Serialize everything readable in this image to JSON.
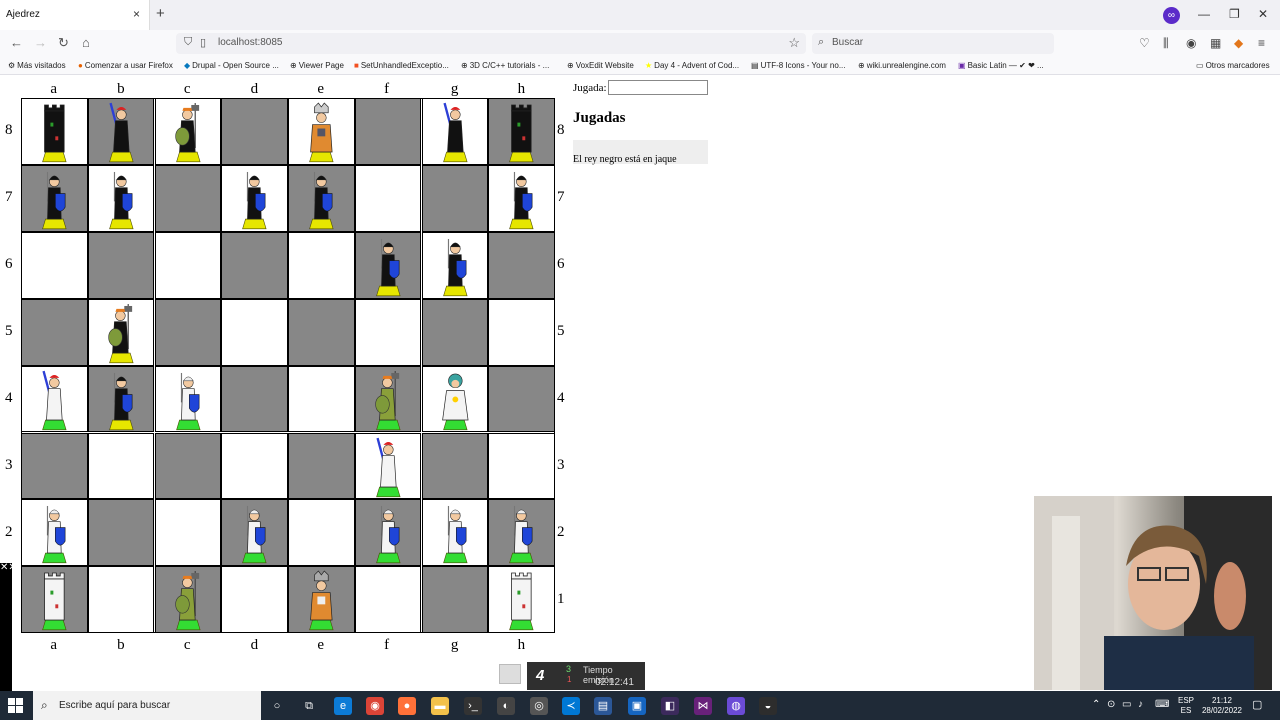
{
  "browser": {
    "tab_title": "Ajedrez",
    "tab_close": "×",
    "new_tab": "+",
    "url": "localhost:8085",
    "search_placeholder": "Buscar",
    "bookmarks": [
      {
        "icon": "firefox-icon",
        "label": "Más visitados"
      },
      {
        "icon": "firefox-icon",
        "label": "Comenzar a usar Firefox"
      },
      {
        "icon": "drupal-icon",
        "label": "Drupal - Open Source ..."
      },
      {
        "icon": "globe-icon",
        "label": "Viewer Page"
      },
      {
        "icon": "microsoft-icon",
        "label": "SetUnhandledExceptio..."
      },
      {
        "icon": "globe-icon",
        "label": "3D C/C++ tutorials - ..."
      },
      {
        "icon": "globe-icon",
        "label": "VoxEdit Website"
      },
      {
        "icon": "star-icon",
        "label": "Day 4 - Advent of Cod..."
      },
      {
        "icon": "chart-icon",
        "label": "UTF-8 Icons - Your no..."
      },
      {
        "icon": "globe-icon",
        "label": "wiki.unrealengine.com"
      },
      {
        "icon": "ut-icon",
        "label": "Basic Latin — ✔ ❤ ..."
      }
    ],
    "other_bookmarks": "Otros marcadores"
  },
  "board": {
    "columns": [
      "a",
      "b",
      "c",
      "d",
      "e",
      "f",
      "g",
      "h"
    ],
    "rows": [
      "8",
      "7",
      "6",
      "5",
      "4",
      "3",
      "2",
      "1"
    ],
    "light_color": "#ffffff",
    "dark_color": "#878787",
    "pieces": [
      {
        "square": "a8",
        "color": "black",
        "type": "rook"
      },
      {
        "square": "b8",
        "color": "black",
        "type": "knight"
      },
      {
        "square": "c8",
        "color": "black",
        "type": "bishop"
      },
      {
        "square": "e8",
        "color": "black",
        "type": "king"
      },
      {
        "square": "g8",
        "color": "black",
        "type": "knight"
      },
      {
        "square": "h8",
        "color": "black",
        "type": "rook"
      },
      {
        "square": "a7",
        "color": "black",
        "type": "pawn"
      },
      {
        "square": "b7",
        "color": "black",
        "type": "pawn"
      },
      {
        "square": "d7",
        "color": "black",
        "type": "pawn"
      },
      {
        "square": "e7",
        "color": "black",
        "type": "pawn"
      },
      {
        "square": "h7",
        "color": "black",
        "type": "pawn"
      },
      {
        "square": "f6",
        "color": "black",
        "type": "pawn"
      },
      {
        "square": "g6",
        "color": "black",
        "type": "pawn"
      },
      {
        "square": "b5",
        "color": "black",
        "type": "bishop"
      },
      {
        "square": "a4",
        "color": "white",
        "type": "knight"
      },
      {
        "square": "b4",
        "color": "black",
        "type": "pawn"
      },
      {
        "square": "c4",
        "color": "white",
        "type": "pawn"
      },
      {
        "square": "f4",
        "color": "white",
        "type": "bishop"
      },
      {
        "square": "g4",
        "color": "white",
        "type": "queen"
      },
      {
        "square": "f3",
        "color": "white",
        "type": "knight"
      },
      {
        "square": "a2",
        "color": "white",
        "type": "pawn"
      },
      {
        "square": "d2",
        "color": "white",
        "type": "pawn"
      },
      {
        "square": "f2",
        "color": "white",
        "type": "pawn"
      },
      {
        "square": "g2",
        "color": "white",
        "type": "pawn"
      },
      {
        "square": "h2",
        "color": "white",
        "type": "pawn"
      },
      {
        "square": "a1",
        "color": "white",
        "type": "rook"
      },
      {
        "square": "c1",
        "color": "white",
        "type": "bishop"
      },
      {
        "square": "e1",
        "color": "white",
        "type": "king"
      },
      {
        "square": "h1",
        "color": "white",
        "type": "rook"
      }
    ]
  },
  "panel": {
    "jugada_label": "Jugada:",
    "jugada_value": "",
    "jugadas_title": "Jugadas",
    "status": "El rey negro está en jaque"
  },
  "overlay": {
    "counter": "4",
    "green_num": "3",
    "red_num": "1",
    "label": "Tiempo emisión",
    "time": "02:12:41"
  },
  "taskbar": {
    "search_placeholder": "Escribe aquí para buscar",
    "lang_top": "ESP",
    "lang_bottom": "ES",
    "time": "21:12",
    "date": "28/02/2022"
  }
}
